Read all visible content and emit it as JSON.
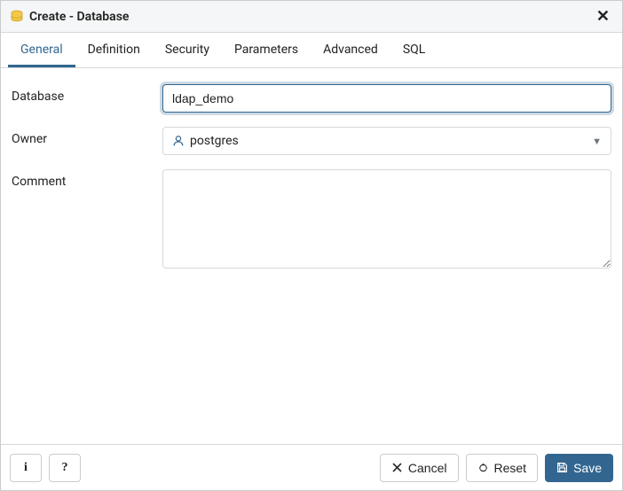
{
  "title": "Create - Database",
  "tabs": [
    {
      "label": "General"
    },
    {
      "label": "Definition"
    },
    {
      "label": "Security"
    },
    {
      "label": "Parameters"
    },
    {
      "label": "Advanced"
    },
    {
      "label": "SQL"
    }
  ],
  "active_tab_index": 0,
  "form": {
    "database_label": "Database",
    "database_value": "ldap_demo",
    "owner_label": "Owner",
    "owner_value": "postgres",
    "comment_label": "Comment",
    "comment_value": ""
  },
  "footer": {
    "info_label": "i",
    "help_label": "?",
    "cancel_label": "Cancel",
    "reset_label": "Reset",
    "save_label": "Save"
  }
}
